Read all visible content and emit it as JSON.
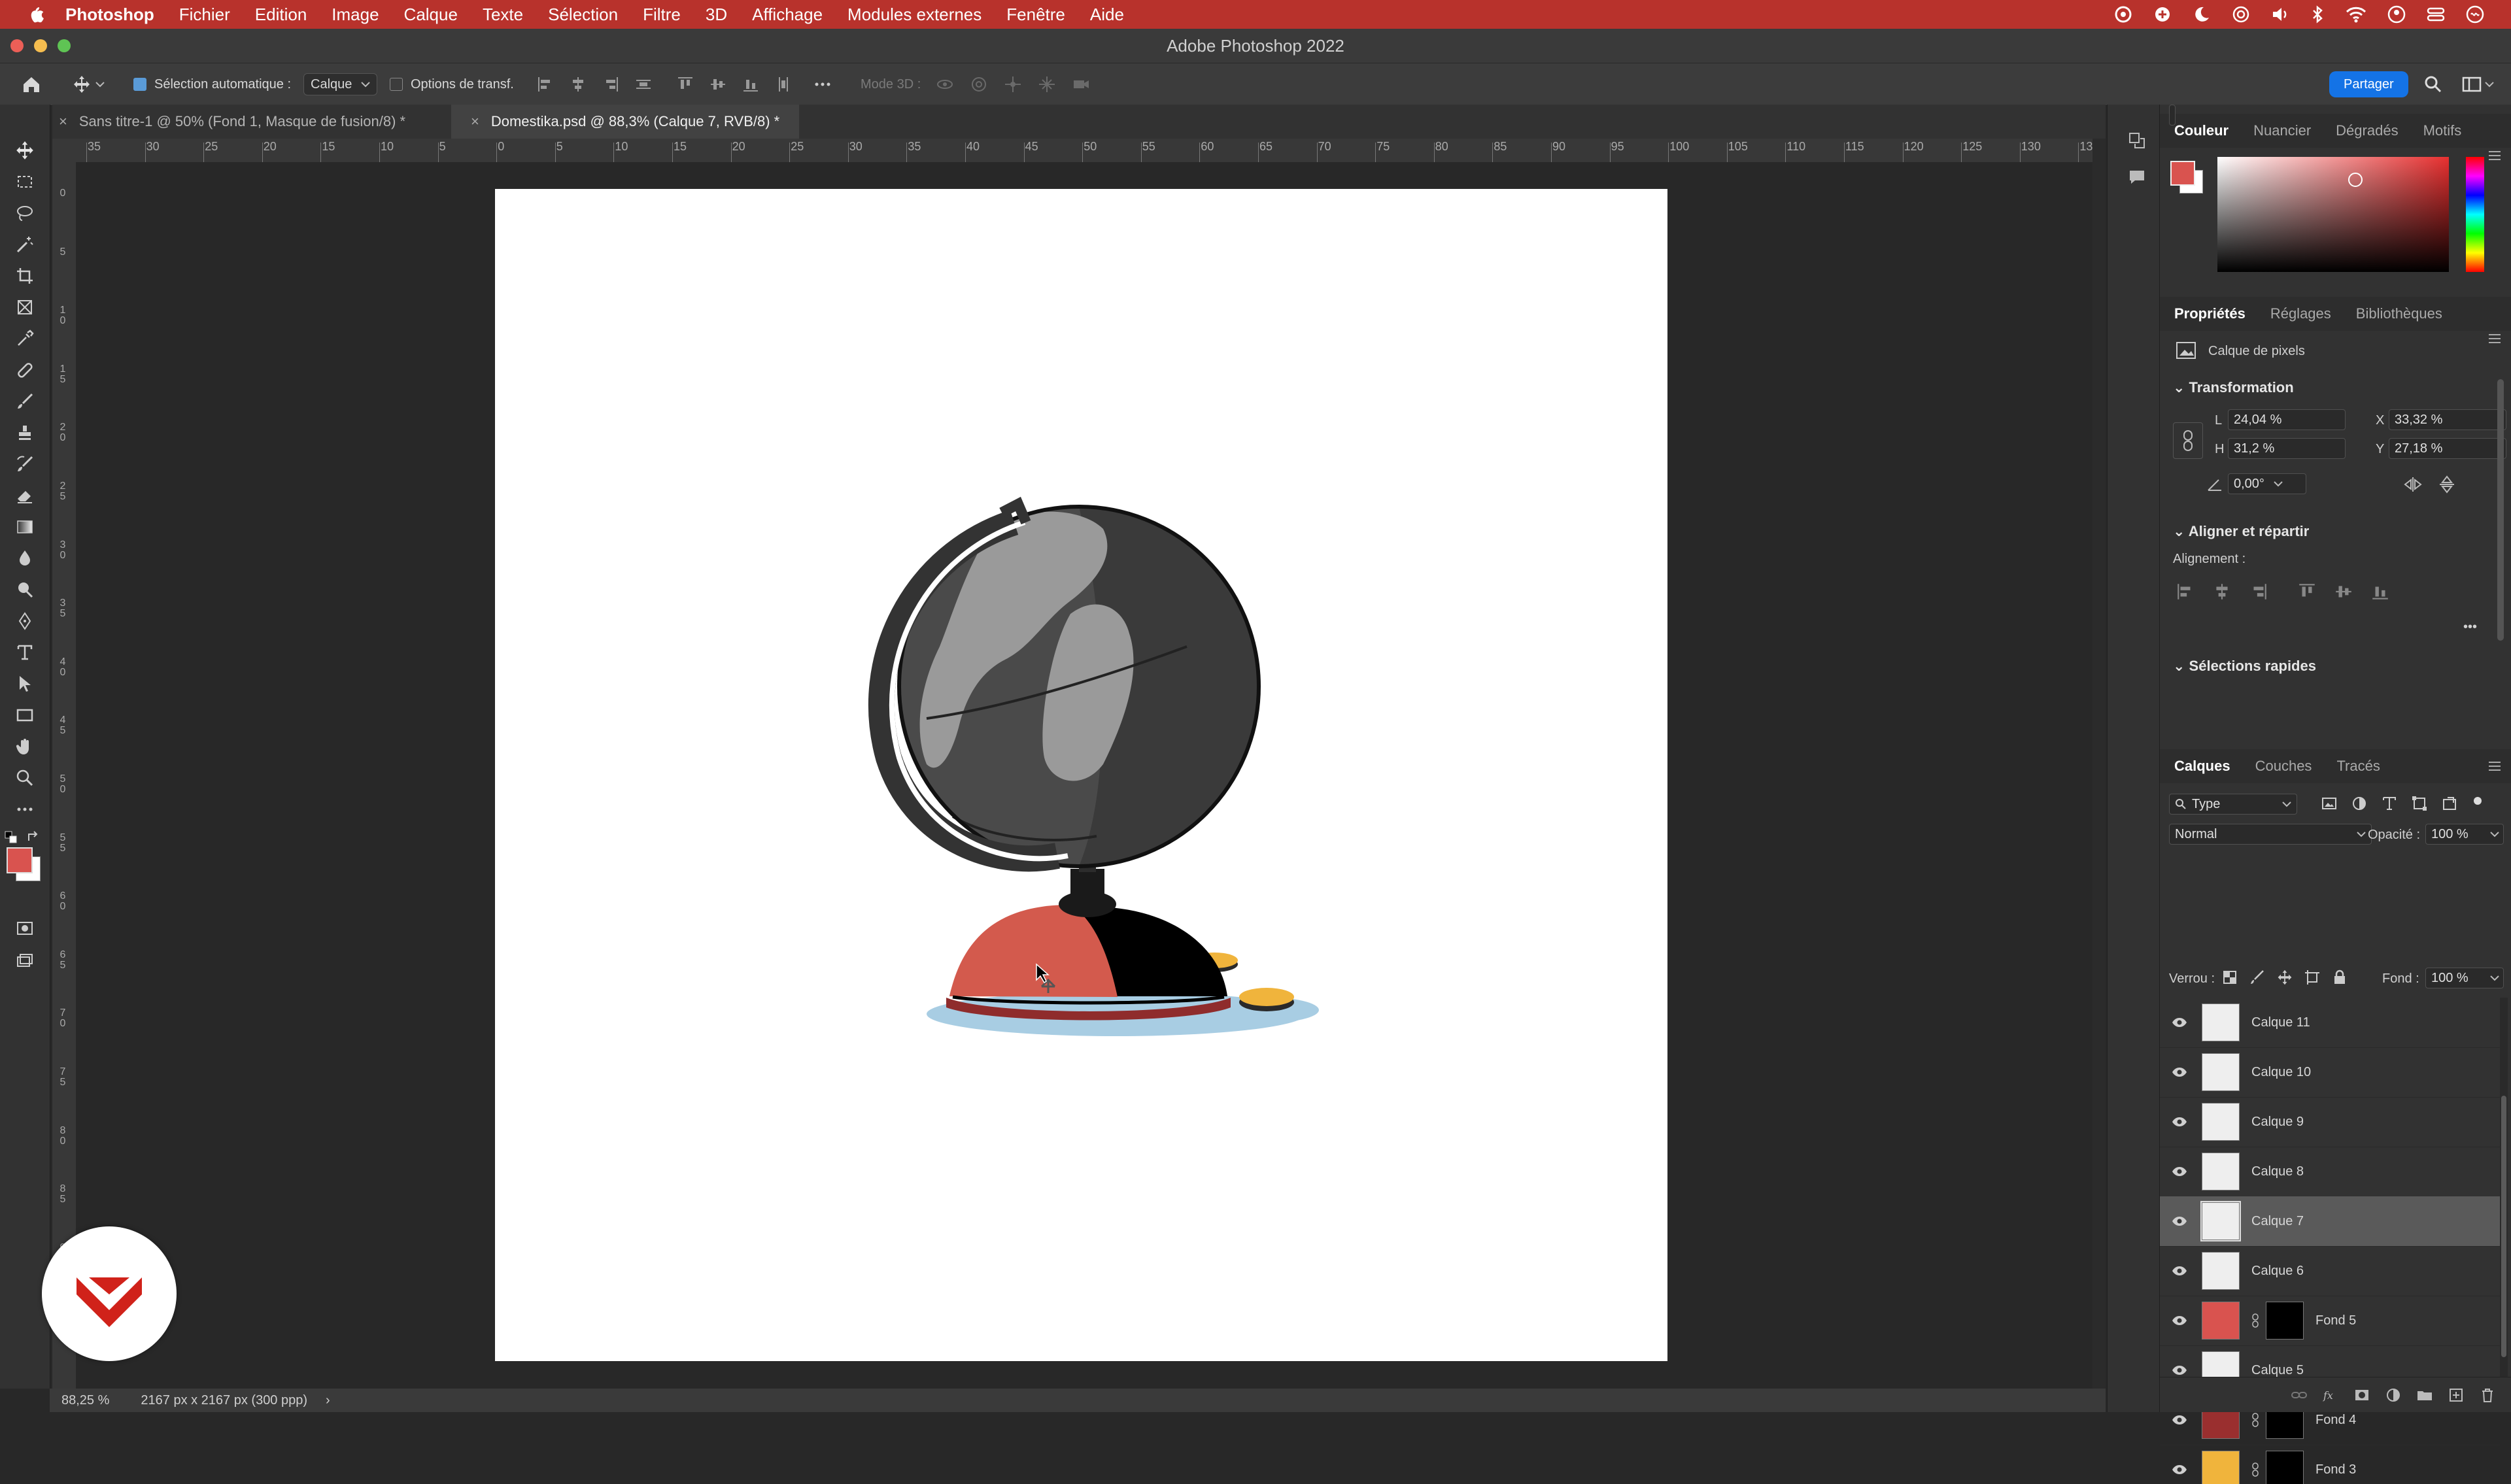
{
  "menubar": {
    "app_name": "Photoshop",
    "items": [
      "Fichier",
      "Edition",
      "Image",
      "Calque",
      "Texte",
      "Sélection",
      "Filtre",
      "3D",
      "Affichage",
      "Modules externes",
      "Fenêtre",
      "Aide"
    ]
  },
  "window": {
    "title": "Adobe Photoshop 2022"
  },
  "options_bar": {
    "auto_select_label": "Sélection automatique :",
    "auto_select_value": "Calque",
    "transform_options_label": "Options de transf.",
    "mode3d_label": "Mode 3D :",
    "share_label": "Partager"
  },
  "tabs": [
    {
      "label": "Sans titre-1 @ 50% (Fond 1, Masque de fusion/8) *",
      "close": "×"
    },
    {
      "label": "Domestika.psd @ 88,3% (Calque 7, RVB/8) *",
      "close": "×"
    }
  ],
  "ruler": {
    "h_labels": [
      "35",
      "30",
      "25",
      "20",
      "15",
      "10",
      "5",
      "0",
      "5",
      "10",
      "15",
      "20",
      "25",
      "30",
      "35",
      "40",
      "45",
      "50",
      "55",
      "60",
      "65",
      "70",
      "75",
      "80",
      "85",
      "90",
      "95",
      "100",
      "105",
      "110",
      "115",
      "120",
      "125",
      "130",
      "13"
    ],
    "v_labels": [
      "0",
      "5",
      "1 0",
      "1 5",
      "2 0",
      "2 5",
      "3 0",
      "3 5",
      "4 0",
      "4 5",
      "5 0",
      "5 5",
      "6 0",
      "6 5",
      "7 0",
      "7 5",
      "8 0",
      "8 5",
      "9 0"
    ]
  },
  "status": {
    "zoom": "88,25 %",
    "doc_info": "2167 px x 2167 px (300 ppp)",
    "arrow": "›"
  },
  "color_panel": {
    "tabs": [
      "Couleur",
      "Nuancier",
      "Dégradés",
      "Motifs"
    ],
    "foreground": "#d9534f",
    "background": "#ffffff"
  },
  "properties_panel": {
    "tabs": [
      "Propriétés",
      "Réglages",
      "Bibliothèques"
    ],
    "layer_type": "Calque de pixels",
    "transform_title": "Transformation",
    "width_label": "L",
    "width_value": "24,04 %",
    "height_label": "H",
    "height_value": "31,2 %",
    "x_label": "X",
    "x_value": "33,32 %",
    "y_label": "Y",
    "y_value": "27,18 %",
    "angle_value": "0,00°",
    "align_title": "Aligner et répartir",
    "alignment_label": "Alignement :",
    "more": "•••",
    "quick_title": "Sélections rapides"
  },
  "layers_panel": {
    "tabs": [
      "Calques",
      "Couches",
      "Tracés"
    ],
    "filter_label": "Type",
    "blend_mode": "Normal",
    "opacity_label": "Opacité :",
    "opacity_value": "100 %",
    "lock_label": "Verrou :",
    "fill_label": "Fond :",
    "fill_value": "100 %",
    "layers": [
      {
        "name": "Calque 11",
        "selected": false,
        "thumb": "#eeeeee",
        "mask": false
      },
      {
        "name": "Calque 10",
        "selected": false,
        "thumb": "#eeeeee",
        "mask": false
      },
      {
        "name": "Calque 9",
        "selected": false,
        "thumb": "#eeeeee",
        "mask": false
      },
      {
        "name": "Calque 8",
        "selected": false,
        "thumb": "#eeeeee",
        "mask": false
      },
      {
        "name": "Calque 7",
        "selected": true,
        "thumb": "#eeeeee",
        "mask": false
      },
      {
        "name": "Calque 6",
        "selected": false,
        "thumb": "#eeeeee",
        "mask": false
      },
      {
        "name": "Fond 5",
        "selected": false,
        "thumb": "#d9534f",
        "mask": true
      },
      {
        "name": "Calque 5",
        "selected": false,
        "thumb": "#eeeeee",
        "mask": false
      },
      {
        "name": "Fond 4",
        "selected": false,
        "thumb": "#9a2f2f",
        "mask": true
      },
      {
        "name": "Fond 3",
        "selected": false,
        "thumb": "#f0b43c",
        "mask": true
      }
    ]
  },
  "colors": {
    "menubar": "#b8322c",
    "accent": "#1473e6",
    "brand_badge": "#d0221a"
  }
}
